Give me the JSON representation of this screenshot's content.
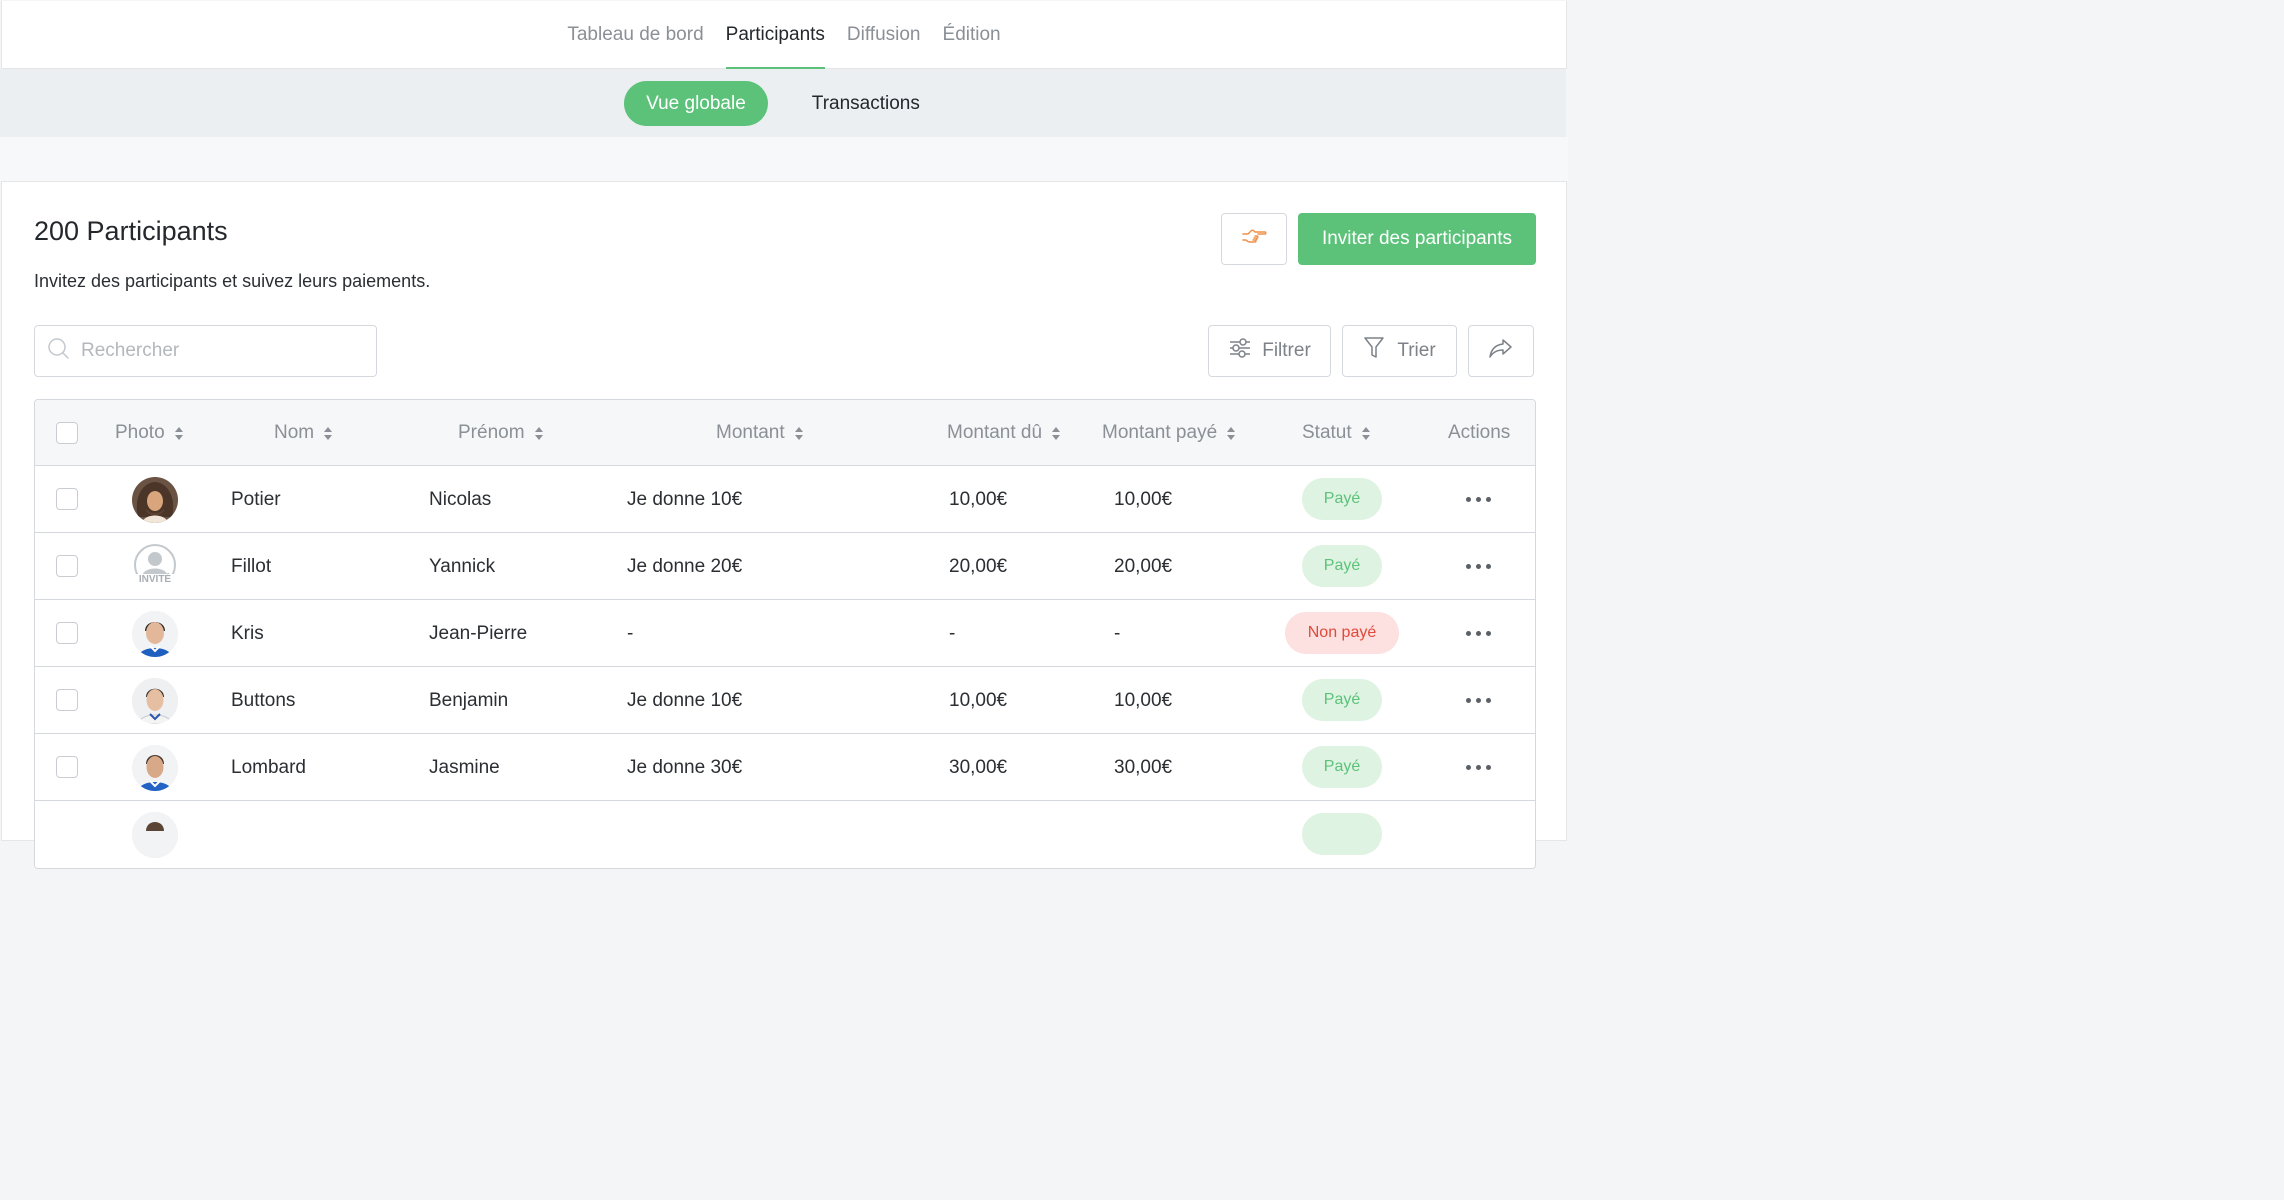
{
  "top_tabs": [
    {
      "label": "Tableau de bord",
      "active": false
    },
    {
      "label": "Participants",
      "active": true
    },
    {
      "label": "Diffusion",
      "active": false
    },
    {
      "label": "Édition",
      "active": false
    }
  ],
  "sub_tabs": [
    {
      "label": "Vue globale",
      "active": true
    },
    {
      "label": "Transactions",
      "active": false
    }
  ],
  "header": {
    "title": "200 Participants",
    "subtitle": "Invitez des participants et suivez leurs paiements.",
    "invite_label": "Inviter des participants"
  },
  "toolbar": {
    "search_placeholder": "Rechercher",
    "filter_label": "Filtrer",
    "sort_label": "Trier"
  },
  "columns": {
    "photo": "Photo",
    "nom": "Nom",
    "prenom": "Prénom",
    "montant": "Montant",
    "montant_du": "Montant dû",
    "montant_paye": "Montant payé",
    "statut": "Statut",
    "actions": "Actions"
  },
  "rows": [
    {
      "nom": "Potier",
      "prenom": "Nicolas",
      "montant": "Je donne 10€",
      "du": "10,00€",
      "paye": "10,00€",
      "statut": "Payé",
      "paid": true,
      "avatar": "curly-hair"
    },
    {
      "nom": "Fillot",
      "prenom": "Yannick",
      "montant": "Je donne 20€",
      "du": "20,00€",
      "paye": "20,00€",
      "statut": "Payé",
      "paid": true,
      "avatar": "invited",
      "avatar_label": "INVITÉ"
    },
    {
      "nom": "Kris",
      "prenom": "Jean-Pierre",
      "montant": "-",
      "du": "-",
      "paye": "-",
      "statut": "Non payé",
      "paid": false,
      "avatar": "player"
    },
    {
      "nom": "Buttons",
      "prenom": "Benjamin",
      "montant": "Je donne 10€",
      "du": "10,00€",
      "paye": "10,00€",
      "statut": "Payé",
      "paid": true,
      "avatar": "player-white"
    },
    {
      "nom": "Lombard",
      "prenom": "Jasmine",
      "montant": "Je donne 30€",
      "du": "30,00€",
      "paye": "30,00€",
      "statut": "Payé",
      "paid": true,
      "avatar": "player-blue"
    }
  ],
  "colors": {
    "accent": "#5cc27a",
    "paid_bg": "#dff3e2",
    "unpaid_bg": "#fde0e0",
    "unpaid_text": "#e04a3a",
    "hand_icon": "#f0904a"
  },
  "icons": {
    "hand": "pointing-hand-icon",
    "search": "search-icon",
    "filter": "sliders-icon",
    "sort": "funnel-icon",
    "share": "share-arrow-icon",
    "more": "more-dots-icon"
  }
}
